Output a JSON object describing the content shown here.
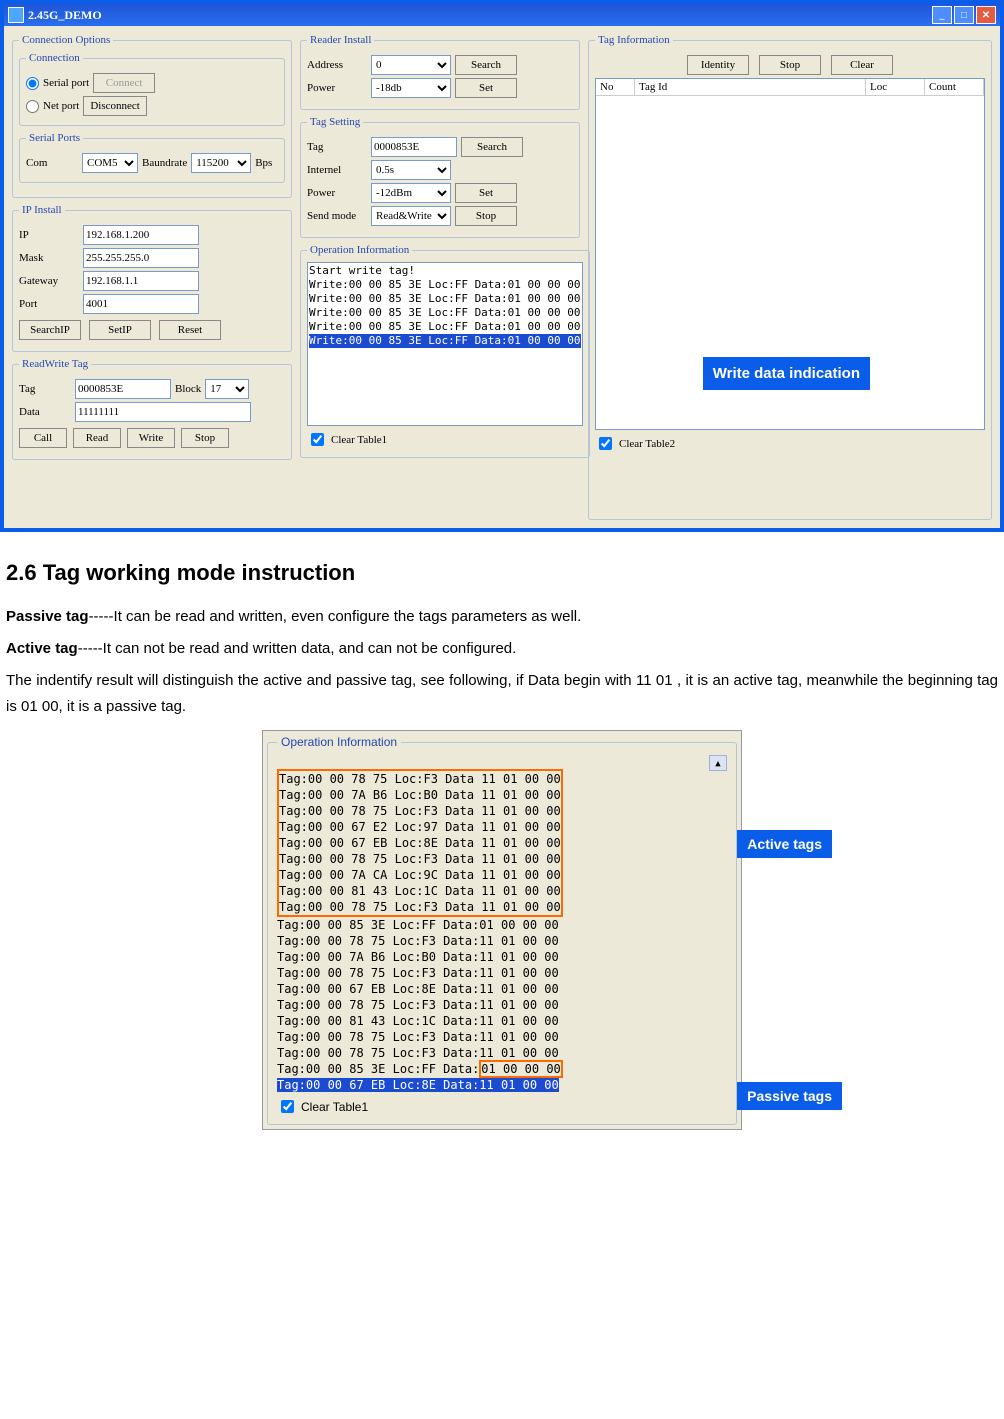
{
  "window": {
    "title": "2.45G_DEMO"
  },
  "groups": {
    "connection_options": "Connection Options",
    "connection": "Connection",
    "serial_ports": "Serial Ports",
    "ip_install": "IP Install",
    "readwrite_tag": "ReadWrite Tag",
    "reader_install": "Reader Install",
    "tag_setting": "Tag Setting",
    "operation_information": "Operation Information",
    "tag_information": "Tag Information"
  },
  "connection": {
    "serial_port": "Serial port",
    "net_port": "Net port",
    "connect": "Connect",
    "disconnect": "Disconnect"
  },
  "serial": {
    "com": "Com",
    "com_value": "COM5",
    "baud": "Baundrate",
    "baud_value": "115200",
    "bps": "Bps"
  },
  "ip": {
    "ip_lbl": "IP",
    "ip_val": "192.168.1.200",
    "mask_lbl": "Mask",
    "mask_val": "255.255.255.0",
    "gw_lbl": "Gateway",
    "gw_val": "192.168.1.1",
    "port_lbl": "Port",
    "port_val": "4001",
    "searchip": "SearchIP",
    "setip": "SetIP",
    "reset": "Reset"
  },
  "rw": {
    "tag_lbl": "Tag",
    "tag_val": "0000853E",
    "block_lbl": "Block",
    "block_val": "17",
    "data_lbl": "Data",
    "data_val": "11111111",
    "call": "Call",
    "read": "Read",
    "write": "Write",
    "stop": "Stop"
  },
  "reader": {
    "address_lbl": "Address",
    "address_val": "0",
    "power_lbl": "Power",
    "power_val": "-18db",
    "search": "Search",
    "set": "Set"
  },
  "tagset": {
    "tag_lbl": "Tag",
    "tag_val": "0000853E",
    "internel_lbl": "Internel",
    "internel_val": "0.5s",
    "power_lbl": "Power",
    "power_val": "-12dBm",
    "send_lbl": "Send mode",
    "send_val": "Read&Write",
    "search": "Search",
    "set": "Set",
    "stop": "Stop"
  },
  "opinfo1": {
    "l0": "Start write tag!",
    "l1": "Write:00 00 85 3E Loc:FF Data:01 00 00 00",
    "l2": "Write:00 00 85 3E Loc:FF Data:01 00 00 00",
    "l3": "Write:00 00 85 3E Loc:FF Data:01 00 00 00",
    "l4": "Write:00 00 85 3E Loc:FF Data:01 00 00 00",
    "sel": "Write:00 00 85 3E Loc:FF Data:01 00 00 00"
  },
  "clear1": "Clear Table1",
  "clear2": "Clear Table2",
  "taginfo": {
    "identity": "Identity",
    "stop": "Stop",
    "clear": "Clear",
    "no": "No",
    "tagid": "Tag Id",
    "loc": "Loc",
    "count": "Count"
  },
  "callouts": {
    "write_data": "Write data indication",
    "active": "Active tags",
    "passive": "Passive tags"
  },
  "doc": {
    "h": "2.6    Tag working mode instruction",
    "p1a": "Passive tag",
    "p1b": "-----It can be read and written, even configure the tags parameters as well.",
    "p2a": "Active tag",
    "p2b": "-----It can not be read and written data, and can not be configured.",
    "p3": "The indentify result will distinguish the active and passive tag, see following, if Data begin with 11 01 , it is an active tag, meanwhile the beginning tag is 01 00, it is a passive tag."
  },
  "opinfo2": {
    "lines_a": [
      "Tag:00 00 78 75 Loc:F3 Data 11 01 00 00",
      "Tag:00 00 7A B6 Loc:B0 Data 11 01 00 00",
      "Tag:00 00 78 75 Loc:F3 Data 11 01 00 00",
      "Tag:00 00 67 E2 Loc:97 Data 11 01 00 00",
      "Tag:00 00 67 EB Loc:8E Data 11 01 00 00",
      "Tag:00 00 78 75 Loc:F3 Data 11 01 00 00",
      "Tag:00 00 7A CA Loc:9C Data 11 01 00 00",
      "Tag:00 00 81 43 Loc:1C Data 11 01 00 00",
      "Tag:00 00 78 75 Loc:F3 Data 11 01 00 00"
    ],
    "lines_b": [
      "Tag:00 00 85 3E Loc:FF Data:01 00 00 00",
      "Tag:00 00 78 75 Loc:F3 Data:11 01 00 00",
      "Tag:00 00 7A B6 Loc:B0 Data:11 01 00 00",
      "Tag:00 00 78 75 Loc:F3 Data:11 01 00 00",
      "Tag:00 00 67 EB Loc:8E Data:11 01 00 00",
      "Tag:00 00 78 75 Loc:F3 Data:11 01 00 00",
      "Tag:00 00 81 43 Loc:1C Data:11 01 00 00",
      "Tag:00 00 78 75 Loc:F3 Data:11 01 00 00",
      "Tag:00 00 78 75 Loc:F3 Data:11 01 00 00"
    ],
    "line_c_pre": "Tag:00 00 85 3E Loc:FF Data:",
    "line_c_box": "01 00 00 00",
    "sel": "Tag:00 00 67 EB Loc:8E Data:11 01 00 00"
  }
}
